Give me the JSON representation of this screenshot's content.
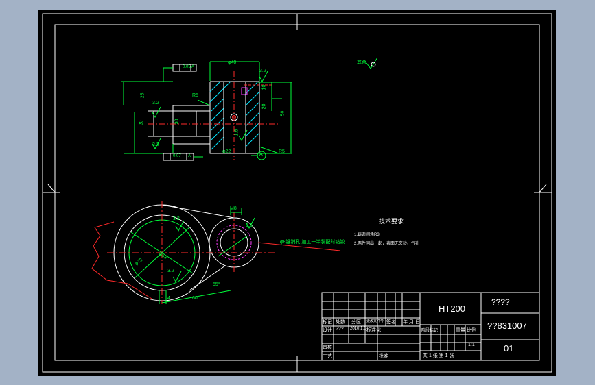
{
  "top_view": {
    "dim_40": "φ40",
    "dim_32_top": "3.2",
    "dim_10": "10",
    "dim_20": "20",
    "dim_58": "58",
    "dim_25": "25",
    "dim_r5_top": "R5",
    "dim_32_left": "3.2",
    "dim_20_bore": "20",
    "dim_30": "30",
    "dim_16": "1.6",
    "dim_32_bottom": "3.2",
    "dim_22": "φ22",
    "dim_r5_bottom": "R5",
    "datum_a": "A",
    "tol_top_value": "0.05",
    "tol_top_ref": "A",
    "tol_bottom_value": "0.07",
    "tol_bottom_ref": "A",
    "roughness_note": "其余"
  },
  "front_view": {
    "dim_m8": "M8",
    "dim_16": "1.6",
    "dim_73": "φ73",
    "dim_53": "φ53",
    "dim_32a": "3.2",
    "dim_32b": "3.2",
    "dim_55": "55°",
    "dim_60": "60",
    "dim_4": "4",
    "leader_note": "φ8锥销孔,加工一半装配时钻铰"
  },
  "tech": {
    "title": "技术要求",
    "line1": "1.铸造圆角R3",
    "line2": "2.两件同出一起，表面无夹砂、气孔"
  },
  "title_block": {
    "material": "HT200",
    "name": "????",
    "drawing_no": "??831007",
    "sheet": "01",
    "scale": "1:1",
    "hdr": [
      "标记",
      "处数",
      "分区",
      "更改文件号",
      "签名",
      "年.月.日"
    ],
    "row_design": [
      "设计",
      "???",
      "2010.1.1",
      "标准化"
    ],
    "row_stage": [
      "阶段标记",
      "重量",
      "比例"
    ],
    "row_review": "审核",
    "row_process": "工艺",
    "row_approve": "批准",
    "total": "共 1 张  第 1 张"
  }
}
